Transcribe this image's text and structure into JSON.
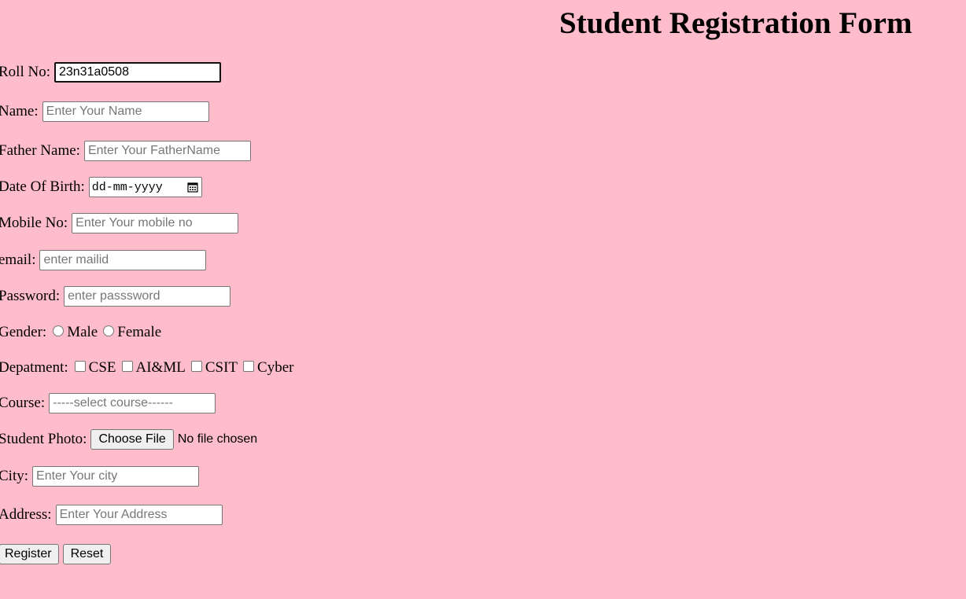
{
  "page": {
    "title": "Student Registration Form",
    "background_color": "#ffbccb"
  },
  "form": {
    "roll_no": {
      "label": "Roll No:",
      "value": "23n31a0508"
    },
    "name": {
      "label": "Name:",
      "placeholder": "Enter Your Name"
    },
    "father_name": {
      "label": "Father Name:",
      "placeholder": "Enter Your FatherName"
    },
    "dob": {
      "label": "Date Of Birth:",
      "placeholder": "dd-mm-yyyy"
    },
    "mobile": {
      "label": "Mobile No:",
      "placeholder": "Enter Your mobile no"
    },
    "email": {
      "label": "email:",
      "placeholder": "enter mailid"
    },
    "password": {
      "label": "Password:",
      "placeholder": "enter passsword"
    },
    "gender": {
      "label": "Gender:",
      "options": [
        "Male",
        "Female"
      ]
    },
    "department": {
      "label": "Depatment:",
      "options": [
        "CSE",
        "AI&ML",
        "CSIT",
        "Cyber"
      ]
    },
    "course": {
      "label": "Course:",
      "placeholder": "-----select course------"
    },
    "photo": {
      "label": "Student Photo:",
      "button_label": "Choose File",
      "status": "No file chosen"
    },
    "city": {
      "label": "City:",
      "placeholder": "Enter Your city"
    },
    "address": {
      "label": "Address:",
      "placeholder": "Enter Your Address"
    },
    "buttons": {
      "register": "Register",
      "reset": "Reset"
    }
  }
}
